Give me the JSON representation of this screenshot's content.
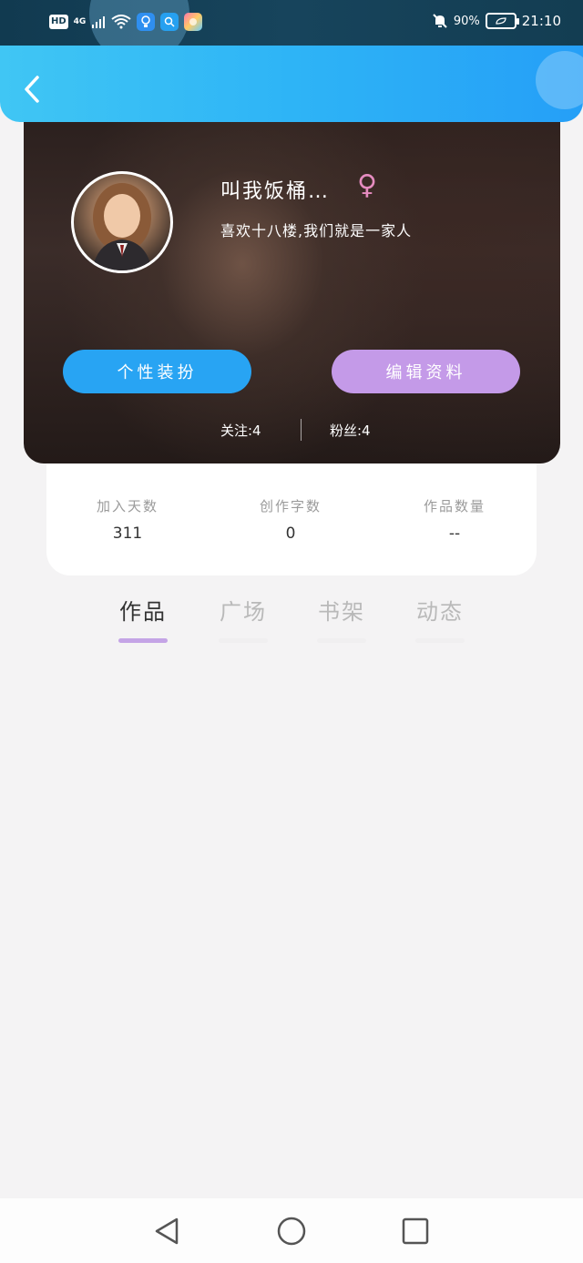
{
  "status_bar": {
    "hd": "HD",
    "network": "4G",
    "battery_percent": "90%",
    "time": "21:10"
  },
  "profile": {
    "name": "叫我饭桶…",
    "gender_symbol": "♀",
    "bio": "喜欢十八楼,我们就是一家人",
    "dress_button": "个性装扮",
    "edit_button": "编辑资料",
    "following": "关注:4",
    "followers": "粉丝:4"
  },
  "stats": [
    {
      "label": "加入天数",
      "value": "311"
    },
    {
      "label": "创作字数",
      "value": "0"
    },
    {
      "label": "作品数量",
      "value": "--"
    }
  ],
  "tabs": [
    {
      "label": "作品",
      "active": true
    },
    {
      "label": "广场",
      "active": false
    },
    {
      "label": "书架",
      "active": false
    },
    {
      "label": "动态",
      "active": false
    }
  ],
  "colors": {
    "header_blue": "#2eb4f6",
    "dress_button": "#28a4f3",
    "edit_button": "#c49ae8",
    "active_tab_underline": "#c4a4e6",
    "gender_pink": "#e58cc0"
  },
  "icons": {
    "back": "chevron-left-icon",
    "nav_back": "triangle-back-icon",
    "nav_home": "circle-home-icon",
    "nav_recents": "square-recents-icon"
  }
}
